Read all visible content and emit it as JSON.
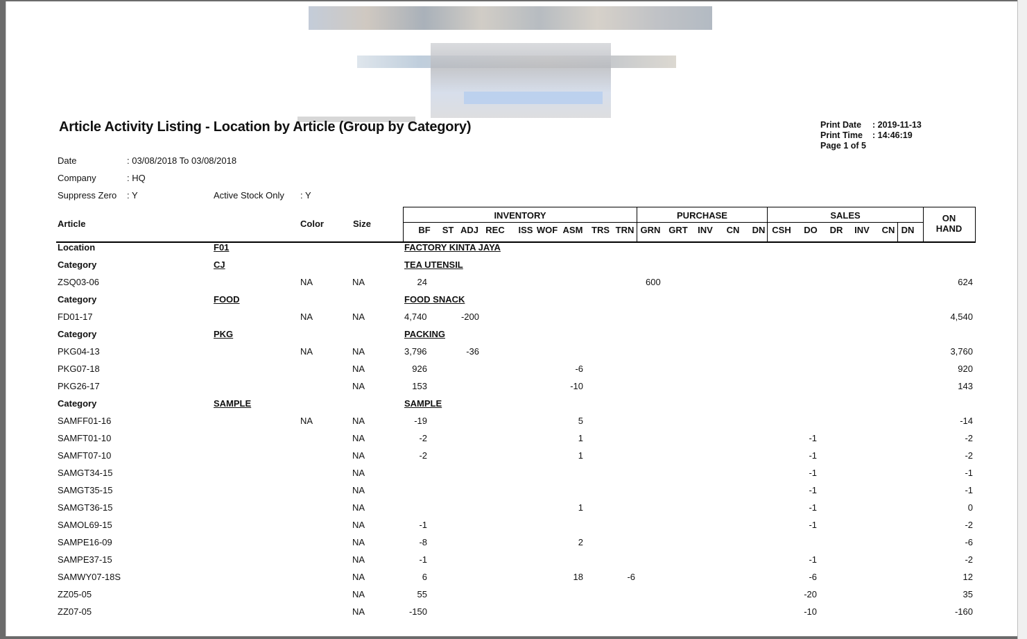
{
  "report": {
    "title": "Article Activity Listing - Location by Article (Group by Category)",
    "print_date_label": "Print Date",
    "print_date": ": 2019-11-13",
    "print_time_label": "Print Time",
    "print_time": ": 14:46:19",
    "page": "Page 1 of 5"
  },
  "filters": {
    "date_label": "Date",
    "date_value": ": 03/08/2018 To 03/08/2018",
    "company_label": "Company",
    "company_value": ": HQ",
    "suppress_label": "Suppress Zero",
    "suppress_value": ": Y",
    "active_label": "Active Stock Only",
    "active_value": ": Y"
  },
  "header": {
    "article": "Article",
    "color": "Color",
    "size": "Size",
    "inventory": "INVENTORY",
    "purchase": "PURCHASE",
    "sales": "SALES",
    "on": "ON",
    "hand": "HAND",
    "sub": [
      "BF",
      "ST",
      "ADJ",
      "REC",
      "ISS",
      "WOF",
      "ASM",
      "TRS",
      "TRN",
      "GRN",
      "GRT",
      "INV",
      "CN",
      "DN",
      "CSH",
      "DO",
      "DR",
      "INV",
      "CN",
      "DN"
    ]
  },
  "location": {
    "label": "Location",
    "code": "F01",
    "name": "FACTORY KINTA JAYA"
  },
  "rows": [
    {
      "type": "cat",
      "label": "Category",
      "code": "CJ",
      "name": "TEA UTENSIL"
    },
    {
      "type": "item",
      "article": "ZSQ03-06",
      "color": "NA",
      "size": "NA",
      "bf": "24",
      "st": "",
      "asm": "",
      "trn": "",
      "grn": "600",
      "do": "",
      "onhand": "624"
    },
    {
      "type": "cat",
      "label": "Category",
      "code": "FOOD",
      "name": "FOOD SNACK"
    },
    {
      "type": "item",
      "article": "FD01-17",
      "color": "NA",
      "size": "NA",
      "bf": "4,740",
      "st": "-200",
      "asm": "",
      "trn": "",
      "grn": "",
      "do": "",
      "onhand": "4,540"
    },
    {
      "type": "cat",
      "label": "Category",
      "code": "PKG",
      "name": "PACKING"
    },
    {
      "type": "item",
      "article": "PKG04-13",
      "color": "NA",
      "size": "NA",
      "bf": "3,796",
      "st": "-36",
      "asm": "",
      "trn": "",
      "grn": "",
      "do": "",
      "onhand": "3,760"
    },
    {
      "type": "item",
      "article": "PKG07-18",
      "color": "",
      "size": "NA",
      "bf": "926",
      "st": "",
      "asm": "-6",
      "trn": "",
      "grn": "",
      "do": "",
      "onhand": "920"
    },
    {
      "type": "item",
      "article": "PKG26-17",
      "color": "",
      "size": "NA",
      "bf": "153",
      "st": "",
      "asm": "-10",
      "trn": "",
      "grn": "",
      "do": "",
      "onhand": "143"
    },
    {
      "type": "cat",
      "label": "Category",
      "code": "SAMPLE",
      "name": "SAMPLE"
    },
    {
      "type": "item",
      "article": "SAMFF01-16",
      "color": "NA",
      "size": "NA",
      "bf": "-19",
      "st": "",
      "asm": "5",
      "trn": "",
      "grn": "",
      "do": "",
      "onhand": "-14"
    },
    {
      "type": "item",
      "article": "SAMFT01-10",
      "color": "",
      "size": "NA",
      "bf": "-2",
      "st": "",
      "asm": "1",
      "trn": "",
      "grn": "",
      "do": "-1",
      "onhand": "-2"
    },
    {
      "type": "item",
      "article": "SAMFT07-10",
      "color": "",
      "size": "NA",
      "bf": "-2",
      "st": "",
      "asm": "1",
      "trn": "",
      "grn": "",
      "do": "-1",
      "onhand": "-2"
    },
    {
      "type": "item",
      "article": "SAMGT34-15",
      "color": "",
      "size": "NA",
      "bf": "",
      "st": "",
      "asm": "",
      "trn": "",
      "grn": "",
      "do": "-1",
      "onhand": "-1"
    },
    {
      "type": "item",
      "article": "SAMGT35-15",
      "color": "",
      "size": "NA",
      "bf": "",
      "st": "",
      "asm": "",
      "trn": "",
      "grn": "",
      "do": "-1",
      "onhand": "-1"
    },
    {
      "type": "item",
      "article": "SAMGT36-15",
      "color": "",
      "size": "NA",
      "bf": "",
      "st": "",
      "asm": "1",
      "trn": "",
      "grn": "",
      "do": "-1",
      "onhand": "0"
    },
    {
      "type": "item",
      "article": "SAMOL69-15",
      "color": "",
      "size": "NA",
      "bf": "-1",
      "st": "",
      "asm": "",
      "trn": "",
      "grn": "",
      "do": "-1",
      "onhand": "-2"
    },
    {
      "type": "item",
      "article": "SAMPE16-09",
      "color": "",
      "size": "NA",
      "bf": "-8",
      "st": "",
      "asm": "2",
      "trn": "",
      "grn": "",
      "do": "",
      "onhand": "-6"
    },
    {
      "type": "item",
      "article": "SAMPE37-15",
      "color": "",
      "size": "NA",
      "bf": "-1",
      "st": "",
      "asm": "",
      "trn": "",
      "grn": "",
      "do": "-1",
      "onhand": "-2"
    },
    {
      "type": "item",
      "article": "SAMWY07-18S",
      "color": "",
      "size": "NA",
      "bf": "6",
      "st": "",
      "asm": "18",
      "trn": "-6",
      "grn": "",
      "do": "-6",
      "onhand": "12"
    },
    {
      "type": "item",
      "article": "ZZ05-05",
      "color": "",
      "size": "NA",
      "bf": "55",
      "st": "",
      "asm": "",
      "trn": "",
      "grn": "",
      "do": "-20",
      "onhand": "35"
    },
    {
      "type": "item",
      "article": "ZZ07-05",
      "color": "",
      "size": "NA",
      "bf": "-150",
      "st": "",
      "asm": "",
      "trn": "",
      "grn": "",
      "do": "-10",
      "onhand": "-160"
    }
  ]
}
